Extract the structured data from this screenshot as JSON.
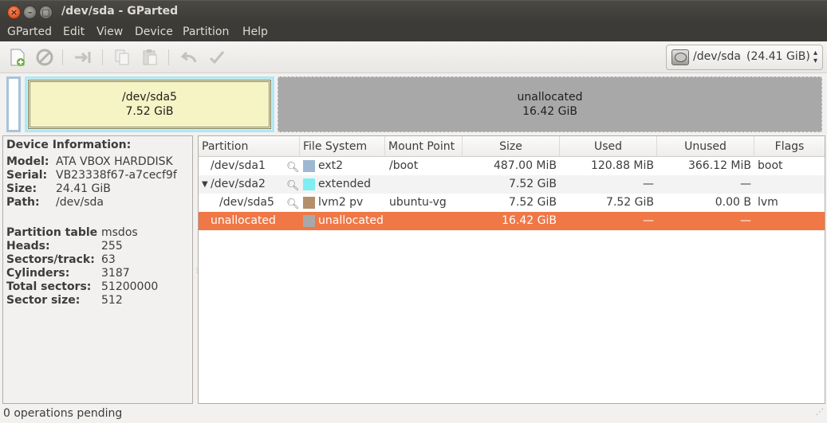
{
  "window": {
    "title": "/dev/sda - GParted"
  },
  "menu": [
    "GParted",
    "Edit",
    "View",
    "Device",
    "Partition",
    "Help"
  ],
  "toolbar": {
    "buttons": [
      "new-icon",
      "delete-icon",
      "resize-move-icon",
      "copy-icon",
      "paste-icon",
      "undo-icon",
      "apply-icon"
    ],
    "device": {
      "name": "/dev/sda",
      "size": "(24.41 GiB)"
    }
  },
  "map": {
    "sda5": {
      "name": "/dev/sda5",
      "size": "7.52 GiB"
    },
    "unallocated": {
      "name": "unallocated",
      "size": "16.42 GiB"
    }
  },
  "device_info": {
    "title": "Device Information:",
    "rows": [
      {
        "k": "Model:",
        "v": "ATA VBOX HARDDISK"
      },
      {
        "k": "Serial:",
        "v": "VB23338f67-a7cecf9f"
      },
      {
        "k": "Size:",
        "v": "24.41 GiB"
      },
      {
        "k": "Path:",
        "v": "/dev/sda"
      }
    ],
    "rows2": [
      {
        "k": "Partition table",
        "v": "msdos"
      },
      {
        "k": "Heads:",
        "v": "255"
      },
      {
        "k": "Sectors/track:",
        "v": "63"
      },
      {
        "k": "Cylinders:",
        "v": "3187"
      },
      {
        "k": "Total sectors:",
        "v": "51200000"
      },
      {
        "k": "Sector size:",
        "v": "512"
      }
    ]
  },
  "table": {
    "headers": [
      "Partition",
      "File System",
      "Mount Point",
      "Size",
      "Used",
      "Unused",
      "Flags"
    ],
    "rows": [
      {
        "partition": "/dev/sda1",
        "fs": "ext2",
        "fs_color": "#9db8d2",
        "mount": "/boot",
        "size": "487.00 MiB",
        "used": "120.88 MiB",
        "unused": "366.12 MiB",
        "flags": "boot"
      },
      {
        "partition": "/dev/sda2",
        "fs": "extended",
        "fs_color": "#7eeef3",
        "mount": "",
        "size": "7.52 GiB",
        "used": "—",
        "unused": "—",
        "flags": ""
      },
      {
        "partition": "/dev/sda5",
        "fs": "lvm2 pv",
        "fs_color": "#b58f6a",
        "mount": "ubuntu-vg",
        "size": "7.52 GiB",
        "used": "7.52 GiB",
        "unused": "0.00 B",
        "flags": "lvm"
      },
      {
        "partition": "unallocated",
        "fs": "unallocated",
        "fs_color": "#a8a8a8",
        "mount": "",
        "size": "16.42 GiB",
        "used": "—",
        "unused": "—",
        "flags": ""
      }
    ]
  },
  "status": {
    "text": "0 operations pending"
  }
}
